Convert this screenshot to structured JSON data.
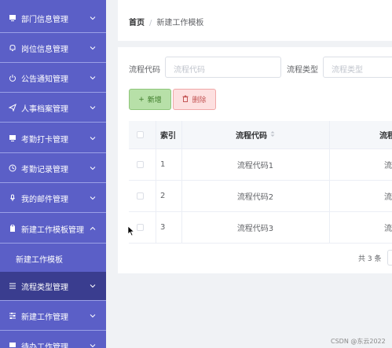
{
  "sidebar": {
    "items": [
      {
        "label": "部门信息管理",
        "icon": "monitor-icon",
        "expanded": false
      },
      {
        "label": "岗位信息管理",
        "icon": "bell-icon",
        "expanded": false
      },
      {
        "label": "公告通知管理",
        "icon": "power-icon",
        "expanded": false
      },
      {
        "label": "人事档案管理",
        "icon": "send-icon",
        "expanded": false
      },
      {
        "label": "考勤打卡管理",
        "icon": "monitor-icon",
        "expanded": false
      },
      {
        "label": "考勤记录管理",
        "icon": "clock-icon",
        "expanded": false
      },
      {
        "label": "我的邮件管理",
        "icon": "microphone-icon",
        "expanded": false
      },
      {
        "label": "新建工作模板管理",
        "icon": "clipboard-icon",
        "expanded": true
      },
      {
        "label": "流程类型管理",
        "icon": "list-icon",
        "expanded": false
      },
      {
        "label": "新建工作管理",
        "icon": "sliders-icon",
        "expanded": false
      },
      {
        "label": "待办工作管理",
        "icon": "monitor-icon",
        "expanded": false
      }
    ],
    "subitems": [
      {
        "label": "新建工作模板"
      }
    ],
    "colors": {
      "bg": "#5b5fc7",
      "active_bg": "#3a3d8f"
    }
  },
  "breadcrumb": {
    "home": "首页",
    "separator": "/",
    "current": "新建工作模板"
  },
  "filters": {
    "code_label": "流程代码",
    "code_placeholder": "流程代码",
    "type_label": "流程类型",
    "type_placeholder": "流程类型"
  },
  "toolbar": {
    "add_label": "新增",
    "add_icon": "+",
    "delete_label": "删除",
    "delete_icon": "trash-icon"
  },
  "table": {
    "headers": {
      "index": "索引",
      "code": "流程代码",
      "type_partial": "流程"
    },
    "sort_icon": "sort-caret-icon",
    "rows": [
      {
        "index": "1",
        "code": "流程代码1",
        "type_partial": "流"
      },
      {
        "index": "2",
        "code": "流程代码2",
        "type_partial": "流"
      },
      {
        "index": "3",
        "code": "流程代码3",
        "type_partial": "流"
      }
    ]
  },
  "pagination": {
    "total_text": "共 3 条"
  },
  "watermark": "CSDN @东云2022"
}
